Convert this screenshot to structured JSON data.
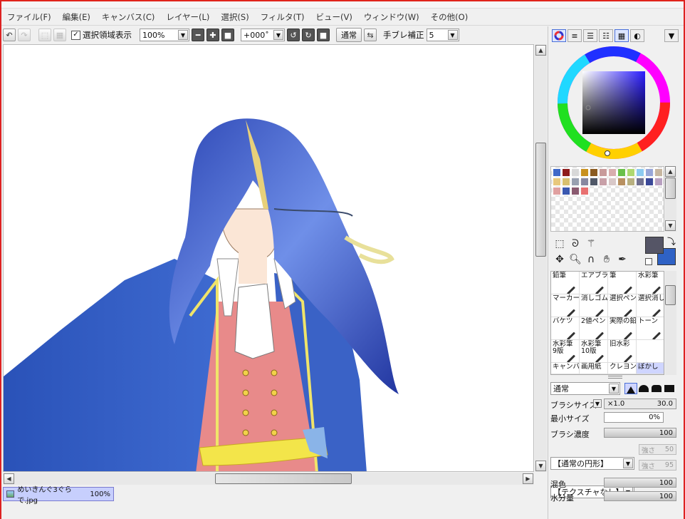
{
  "menu": [
    "ファイル(F)",
    "編集(E)",
    "キャンバス(C)",
    "レイヤー(L)",
    "選択(S)",
    "フィルタ(T)",
    "ビュー(V)",
    "ウィンドウ(W)",
    "その他(O)"
  ],
  "toolbar": {
    "show_selection_label": "選択領域表示",
    "show_selection_checked": "✓",
    "zoom_value": "100%",
    "rotation_value": "+000˚",
    "blend_button": "通常",
    "stabilizer_label": "手ブレ補正",
    "stabilizer_value": "5"
  },
  "document": {
    "name": "めいきんぐ3ぐらで.jpg",
    "zoom": "100%"
  },
  "panel": {
    "palette_colors": [
      "#3f68c8",
      "#8e1b1b",
      "#d8d8d8",
      "#c8901e",
      "#8a5a20",
      "#c89a9a",
      "#d8aeae",
      "#6ac04a",
      "#aed870",
      "#8ccaf0",
      "#98a6d8",
      "#c7b6a0",
      "#e8c87c",
      "#d8c070",
      "#98a0b0",
      "#8888a0",
      "#505868",
      "#c8a0a8",
      "#d8c8c8",
      "#b89060",
      "#b8b080",
      "#707090",
      "#3a4898",
      "#b8a0c0",
      "#e0a0a0",
      "#3a58b0",
      "#8a5a70",
      "#e87070"
    ],
    "main_color": "#555566",
    "sub_color": "#2f62c5",
    "brushes": [
      {
        "label": "鉛筆",
        "label2": ""
      },
      {
        "label": "エアブラシ",
        "label2": ""
      },
      {
        "label": "筆",
        "label2": ""
      },
      {
        "label": "水彩筆",
        "label2": ""
      },
      {
        "label": "マーカー",
        "label2": ""
      },
      {
        "label": "消しゴム",
        "label2": ""
      },
      {
        "label": "選択ペン",
        "label2": ""
      },
      {
        "label": "選択消し",
        "label2": ""
      },
      {
        "label": "バケツ",
        "label2": ""
      },
      {
        "label": "2値ペン",
        "label2": ""
      },
      {
        "label": "実際の鉛",
        "label2": ""
      },
      {
        "label": "トーン",
        "label2": ""
      },
      {
        "label": "水彩筆",
        "label2": "9版"
      },
      {
        "label": "水彩筆",
        "label2": "10版"
      },
      {
        "label": "旧水彩",
        "label2": ""
      },
      {
        "label": "",
        "label2": ""
      },
      {
        "label": "キャンバス",
        "label2": ""
      },
      {
        "label": "画用紙",
        "label2": ""
      },
      {
        "label": "クレヨン",
        "label2": ""
      },
      {
        "label": "ぼかし",
        "label2": ""
      }
    ],
    "blend_mode": "通常",
    "brush_size_label": "ブラシサイズ",
    "brush_size_mult": "×1.0",
    "brush_size_value": "30.0",
    "min_size_label": "最小サイズ",
    "min_size_value": "0%",
    "density_label": "ブラシ濃度",
    "density_value": "100",
    "shape_select": "【通常の円形】",
    "shape_strength_label": "強さ",
    "shape_strength_value": "50",
    "texture_select": "【テクスチャなし】",
    "texture_strength_label": "強さ",
    "texture_strength_value": "95",
    "mix_label": "混色",
    "mix_value": "100",
    "water_label": "水分量",
    "water_value": "100"
  },
  "colors": {
    "accent": "#4a6fd8",
    "tab_selected": "#c7cffd"
  }
}
